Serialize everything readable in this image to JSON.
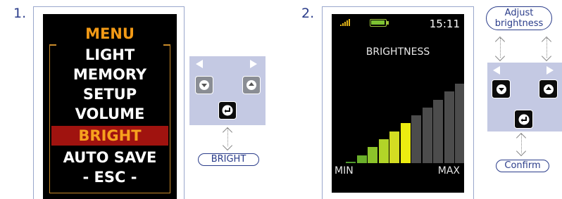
{
  "steps": [
    {
      "number": "1.",
      "menu": {
        "title": "MENU",
        "items": [
          "LIGHT",
          "MEMORY",
          "SETUP",
          "VOLUME",
          "BRIGHT",
          "AUTO SAVE",
          "- ESC -"
        ],
        "selected": "BRIGHT"
      },
      "callout": "BRIGHT"
    },
    {
      "number": "2.",
      "status": {
        "time": "15:11",
        "battery_level": 1.0
      },
      "screen_title": "BRIGHTNESS",
      "min_label": "MIN",
      "max_label": "MAX",
      "brightness": {
        "total_steps": 11,
        "current_step": 6
      },
      "callout_top": "Adjust brightness",
      "callout_bottom": "Confirm"
    }
  ],
  "colors": {
    "accent": "#2a3c8a",
    "menu_title": "#f29a16",
    "selected_bg": "#a0130f",
    "keypad_bg": "#c4c9e3",
    "bar_active": [
      "#4f9a2c",
      "#6aaf2a",
      "#8cc32a",
      "#b2d428",
      "#d4dc22",
      "#ecec10"
    ],
    "bar_inactive": "#4c4c4c"
  },
  "icons": [
    "left-arrow-icon",
    "right-arrow-icon",
    "down-key-icon",
    "up-key-icon",
    "enter-key-icon",
    "signal-icon",
    "battery-icon"
  ]
}
